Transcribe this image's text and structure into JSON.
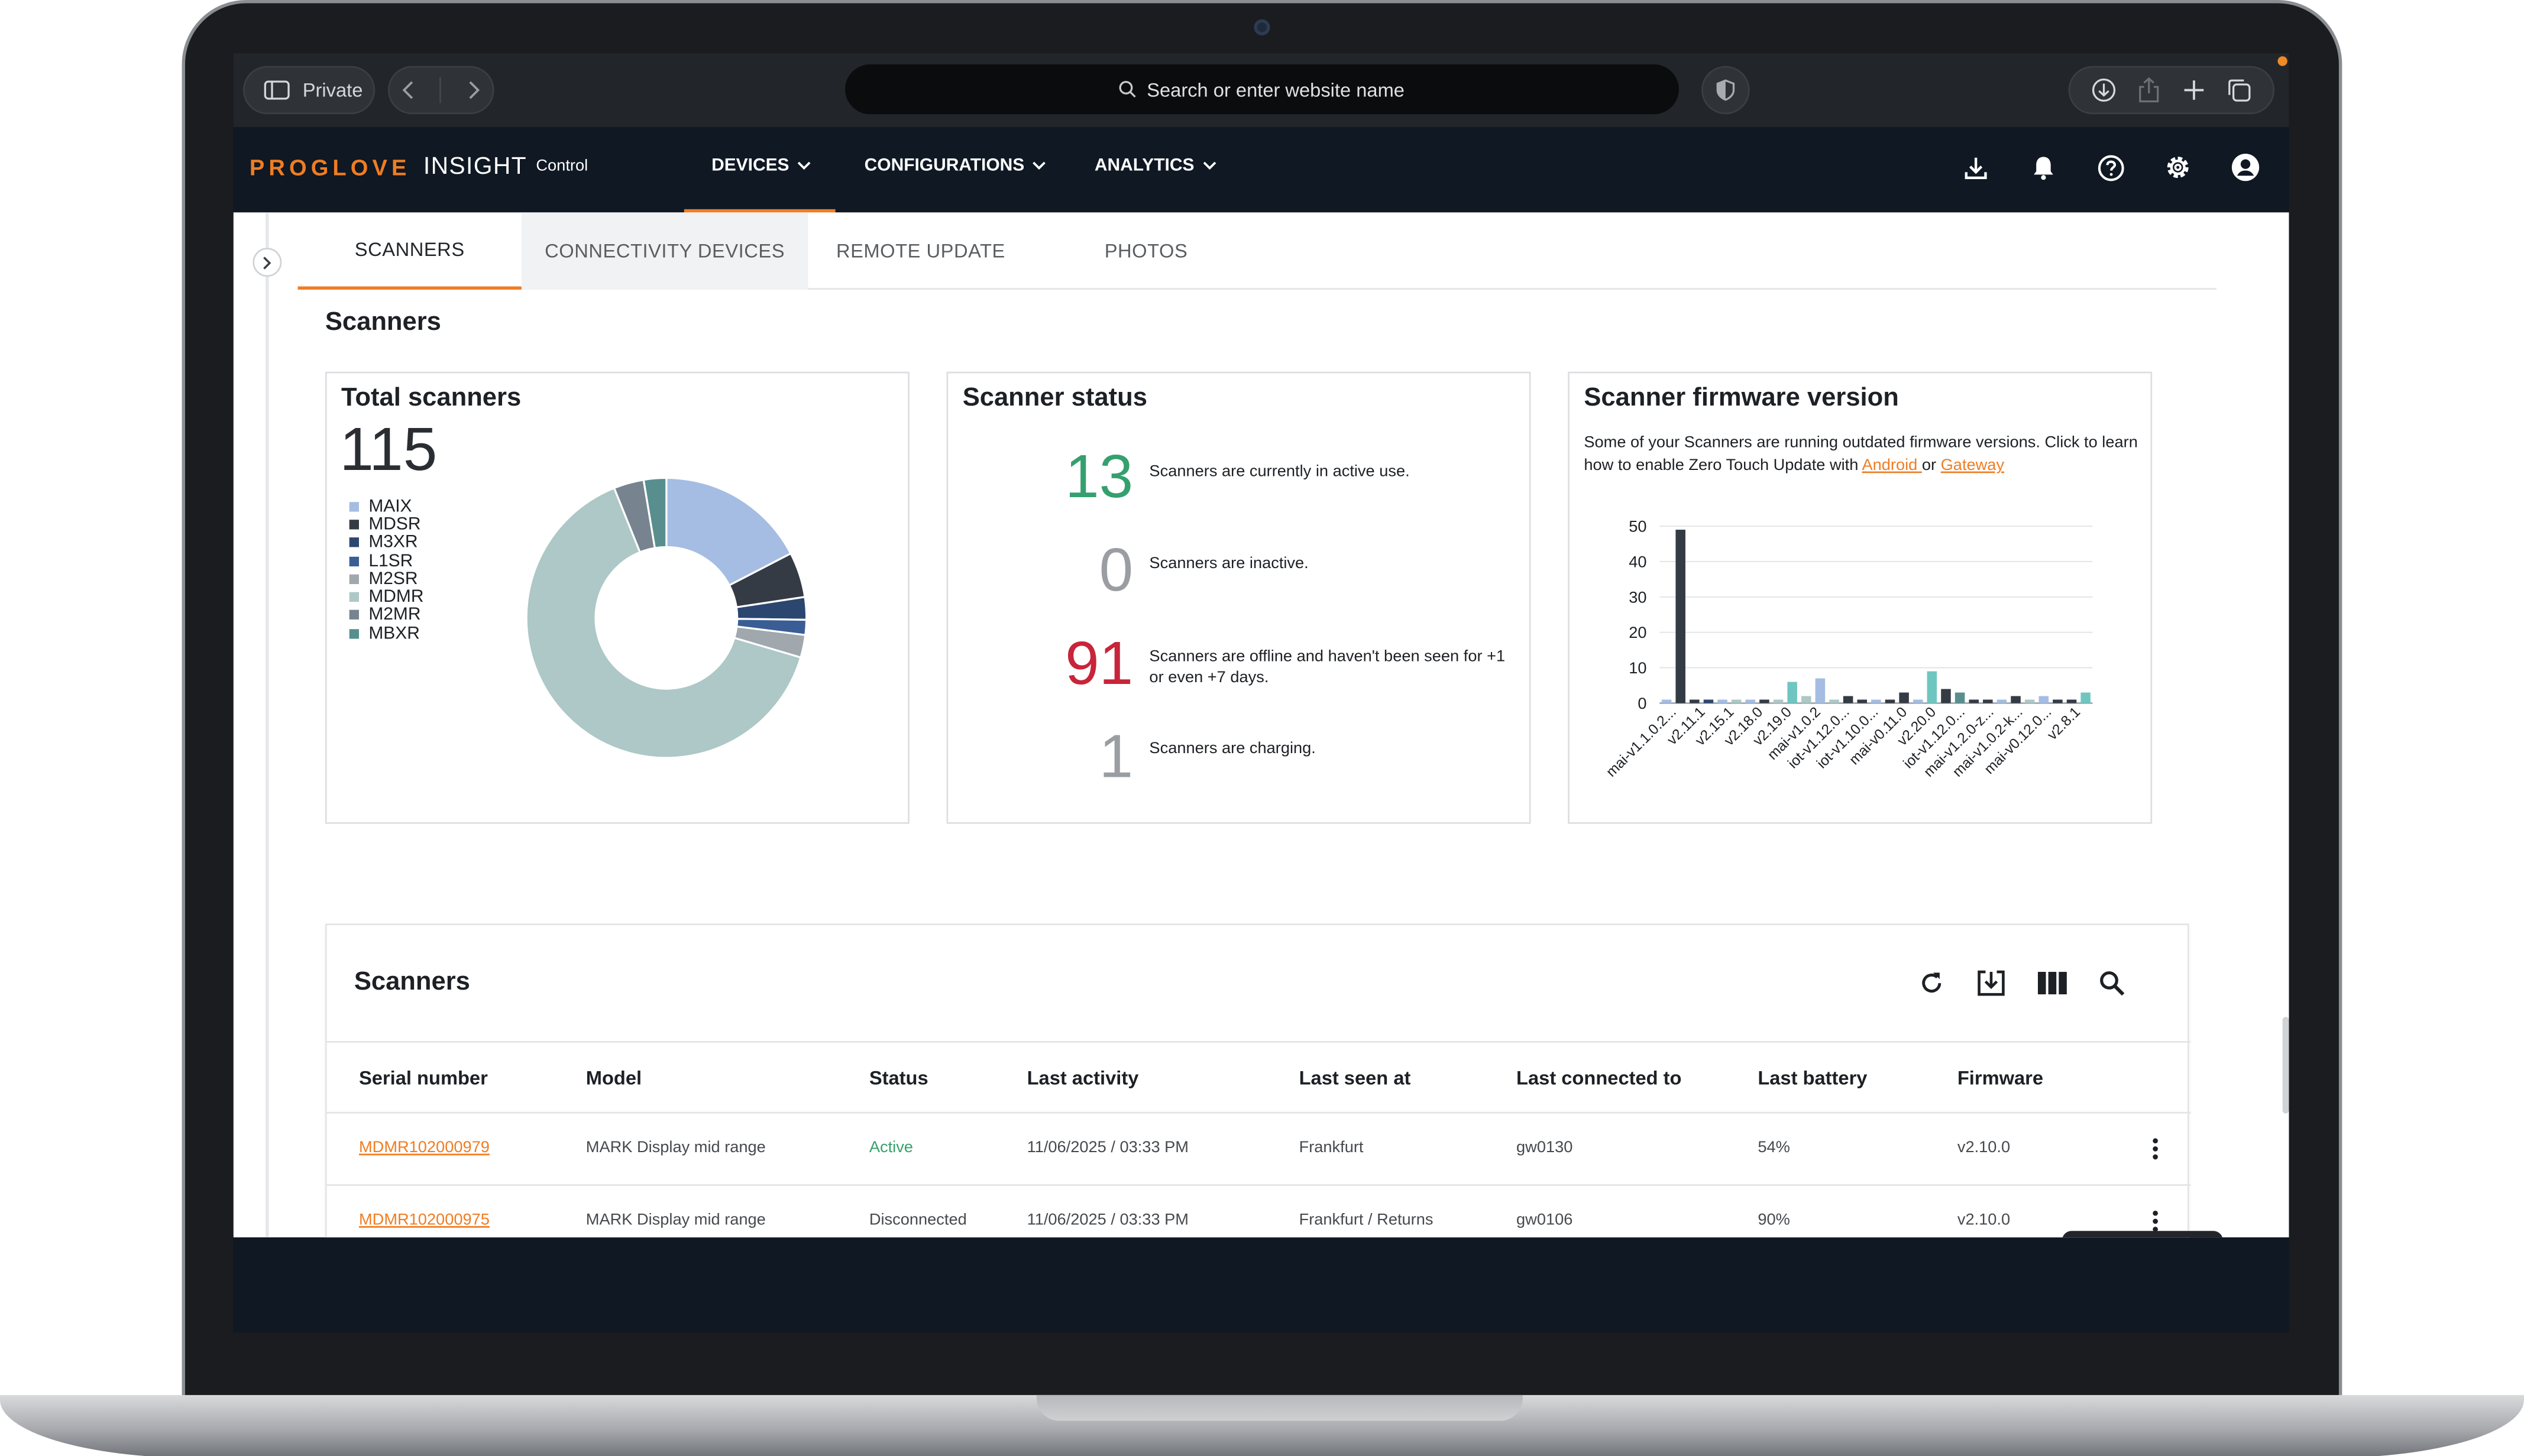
{
  "browser": {
    "private_label": "Private",
    "address_placeholder": "Search or enter website name"
  },
  "app": {
    "logo_brand": "PROGLOVE",
    "logo_product": "INSIGHT",
    "logo_edition": "Control",
    "menu": [
      {
        "label": "DEVICES"
      },
      {
        "label": "CONFIGURATIONS"
      },
      {
        "label": "ANALYTICS"
      }
    ]
  },
  "tabs": [
    {
      "label": "SCANNERS",
      "active": true
    },
    {
      "label": "CONNECTIVITY DEVICES"
    },
    {
      "label": "REMOTE UPDATE"
    },
    {
      "label": "PHOTOS"
    }
  ],
  "section_title": "Scanners",
  "total_scanners": {
    "title": "Total scanners",
    "value": "115",
    "legend": [
      {
        "label": "MAIX",
        "color": "#a5bde2"
      },
      {
        "label": "MDSR",
        "color": "#353b45"
      },
      {
        "label": "M3XR",
        "color": "#2b4770"
      },
      {
        "label": "L1SR",
        "color": "#3a5d96"
      },
      {
        "label": "M2SR",
        "color": "#a0a8ad"
      },
      {
        "label": "MDMR",
        "color": "#adc8c6"
      },
      {
        "label": "M2MR",
        "color": "#77848f"
      },
      {
        "label": "MBXR",
        "color": "#588f8e"
      }
    ]
  },
  "scanner_status": {
    "title": "Scanner status",
    "items": [
      {
        "value": "13",
        "text": "Scanners are currently in active use.",
        "color": "#35a06e"
      },
      {
        "value": "0",
        "text": "Scanners are inactive.",
        "color": "#9a9da1"
      },
      {
        "value": "91",
        "text": "Scanners are offline and haven't been seen for +1 or even +7 days.",
        "color": "#c8243a"
      },
      {
        "value": "1",
        "text": "Scanners are charging.",
        "color": "#9a9da1"
      }
    ]
  },
  "firmware": {
    "title": "Scanner firmware version",
    "desc_before": "Some of your Scanners are running outdated firmware versions. Click to learn how to enable Zero Touch Update with ",
    "link_android": "Android ",
    "desc_or": "or ",
    "link_gateway": "Gateway"
  },
  "chart_data": [
    {
      "type": "pie",
      "title": "Total scanners",
      "categories": [
        "MAIX",
        "MDSR",
        "M3XR",
        "L1SR",
        "M2SR",
        "MDMR",
        "M2MR",
        "MBXR"
      ],
      "values": [
        20,
        6,
        3,
        2,
        3,
        74,
        4,
        3
      ]
    },
    {
      "type": "bar",
      "title": "Scanner firmware version",
      "ylim": [
        0,
        50
      ],
      "yticks": [
        0,
        10,
        20,
        30,
        40,
        50
      ],
      "tick_labels": [
        "mai-v1.1.0.2...",
        "v2.11.1",
        "v2.15.1",
        "v2.18.0",
        "v2.19.0",
        "mai-v1.0.2",
        "iot-v1.12.0...",
        "iot-v1.10.0...",
        "mai-v0.11.0",
        "v2.20.0",
        "iot-v1.12.0...",
        "mai-v1.2.0-z...",
        "mai-v1.0.2-k...",
        "mai-v0.12.0...",
        "v2.8.1"
      ],
      "values": [
        1,
        49,
        1,
        1,
        1,
        1,
        1,
        1,
        1,
        6,
        2,
        7,
        1,
        2,
        1,
        1,
        1,
        3,
        1,
        9,
        4,
        3,
        1,
        1,
        1,
        2,
        1,
        2,
        1,
        1,
        3
      ],
      "colors": [
        "#a5bde2",
        "#353b45",
        "#353b45",
        "#2b4770",
        "#a5bde2",
        "#adc8c6",
        "#a5bde2",
        "#353b45",
        "#adc8c6",
        "#6fc6c0",
        "#adc8c6",
        "#a5bde2",
        "#adc8c6",
        "#353b45",
        "#353b45",
        "#a5bde2",
        "#353b45",
        "#353b45",
        "#a5bde2",
        "#6fc6c0",
        "#353b45",
        "#588f8e",
        "#353b45",
        "#353b45",
        "#a5bde2",
        "#353b45",
        "#adc8c6",
        "#a5bde2",
        "#353b45",
        "#353b45",
        "#6fc6c0"
      ]
    }
  ],
  "table": {
    "title": "Scanners",
    "columns": [
      "Serial number",
      "Model",
      "Status",
      "Last activity",
      "Last seen at",
      "Last connected to",
      "Last battery",
      "Firmware"
    ],
    "rows": [
      {
        "serial": "MDMR102000979",
        "model": "MARK Display mid range",
        "status": "Active",
        "last_activity": "11/06/2025 / 03:33 PM",
        "last_seen": "Frankfurt",
        "connected": "gw0130",
        "battery": "54%",
        "firmware": "v2.10.0"
      },
      {
        "serial": "MDMR102000975",
        "model": "MARK Display mid range",
        "status": "Disconnected",
        "last_activity": "11/06/2025 / 03:33 PM",
        "last_seen": "Frankfurt / Returns",
        "connected": "gw0106",
        "battery": "90%",
        "firmware": "v2.10.0"
      }
    ]
  },
  "colors": {
    "accent": "#ef7d23",
    "header_bg": "#0f1823",
    "active_green": "#35a06e",
    "offline_red": "#c8243a"
  }
}
